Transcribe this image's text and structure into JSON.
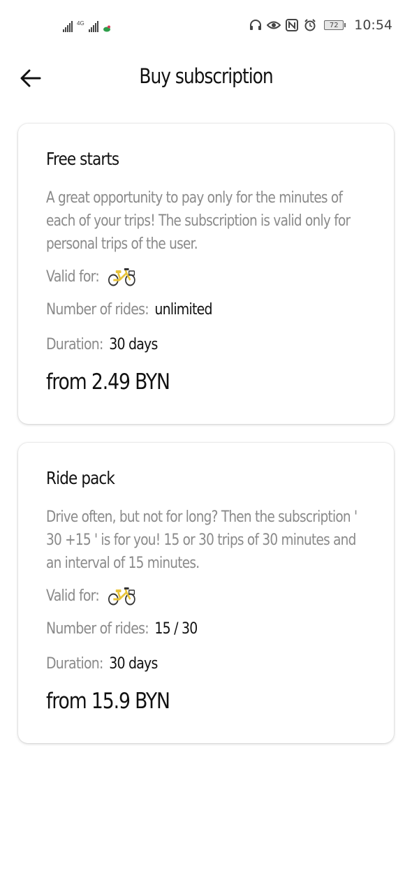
{
  "status_bar": {
    "network_label": "4G",
    "battery_level": "72",
    "time": "10:54",
    "icons": [
      "signal-icon",
      "signal-icon",
      "leaf-icon",
      "headphones-icon",
      "eye-icon",
      "nfc-icon",
      "alarm-icon",
      "battery-icon"
    ]
  },
  "header": {
    "title": "Buy subscription",
    "back_icon": "arrow-left-icon"
  },
  "subscriptions": [
    {
      "title": "Free starts",
      "description": "A great opportunity to pay only for the minutes of each of your trips! The subscription is valid only for personal trips of the user.",
      "valid_for_label": "Valid for:",
      "valid_for_icon": "bicycle-icon",
      "rides_label": "Number of rides:",
      "rides_value": "unlimited",
      "duration_label": "Duration:",
      "duration_value": "30 days",
      "price": "from 2.49 BYN"
    },
    {
      "title": "Ride pack",
      "description": "Drive often, but not for long? Then the subscription ' 30 +15 ' is for you! 15 or 30 trips of 30 minutes and an interval of 15 minutes.",
      "valid_for_label": "Valid for:",
      "valid_for_icon": "bicycle-icon",
      "rides_label": "Number of rides:",
      "rides_value": "15 / 30",
      "duration_label": "Duration:",
      "duration_value": "30 days",
      "price": "from 15.9 BYN"
    }
  ],
  "colors": {
    "bike_frame": "#e8c33a",
    "text_secondary": "#8a8a8a",
    "text_primary": "#111111"
  }
}
